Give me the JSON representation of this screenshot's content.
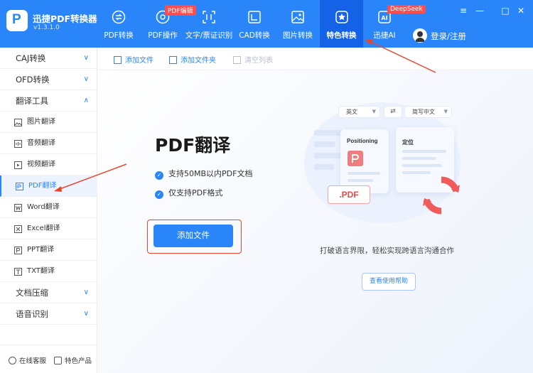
{
  "app": {
    "name": "迅捷PDF转换器",
    "version": "v1.3.1.0"
  },
  "nav": [
    {
      "label": "PDF转换",
      "icon": "swap-icon"
    },
    {
      "label": "PDF操作",
      "icon": "settings-icon"
    },
    {
      "label": "文字/票证识别",
      "icon": "scan-icon"
    },
    {
      "label": "CAD转换",
      "icon": "cad-icon"
    },
    {
      "label": "图片转换",
      "icon": "image-icon"
    },
    {
      "label": "特色转换",
      "icon": "star-icon",
      "active": true
    },
    {
      "label": "迅捷AI",
      "icon": "ai-icon"
    }
  ],
  "badges": {
    "pdf": "PDF编辑",
    "deepseek": "DeepSeek"
  },
  "user": {
    "login": "登录/注册"
  },
  "window": {
    "menu": "≡",
    "minimize": "—",
    "maximize": "□",
    "close": "✕"
  },
  "sidebar": {
    "groups": [
      {
        "label": "CAJ转换",
        "chevron": "∨"
      },
      {
        "label": "OFD转换",
        "chevron": "∨"
      },
      {
        "label": "翻译工具",
        "chevron": "∧"
      }
    ],
    "sub_items": [
      {
        "label": "图片翻译",
        "icon": "image-icon"
      },
      {
        "label": "音频翻译",
        "icon": "audio-icon"
      },
      {
        "label": "视频翻译",
        "icon": "video-icon"
      },
      {
        "label": "PDF翻译",
        "icon": "pdf-icon",
        "active": true
      },
      {
        "label": "Word翻译",
        "icon": "word-icon"
      },
      {
        "label": "Excel翻译",
        "icon": "excel-icon"
      },
      {
        "label": "PPT翻译",
        "icon": "ppt-icon"
      },
      {
        "label": "TXT翻译",
        "icon": "txt-icon"
      }
    ],
    "bottom_groups": [
      {
        "label": "文档压缩",
        "chevron": "∨"
      },
      {
        "label": "语音识别",
        "chevron": "∨"
      }
    ],
    "footer": {
      "service": "在线客服",
      "products": "特色产品"
    }
  },
  "toolbar": {
    "add_file": "添加文件",
    "add_folder": "添加文件夹",
    "clear_list": "清空列表"
  },
  "main": {
    "title": "PDF翻译",
    "features": [
      "支持50MB以内PDF文档",
      "仅支持PDF格式"
    ],
    "add_button": "添加文件",
    "source_lang": "英文",
    "target_lang": "简写中文",
    "swap": "⇄",
    "card_left_title": "Positioning",
    "card_right_title": "定位",
    "pdf_tag": ".PDF",
    "slogan": "打破语言界限，轻松实现跨语言沟通合作",
    "guide_button": "查看使用帮助"
  },
  "colors": {
    "primary": "#2a86f8",
    "annotation": "#e8452c"
  }
}
